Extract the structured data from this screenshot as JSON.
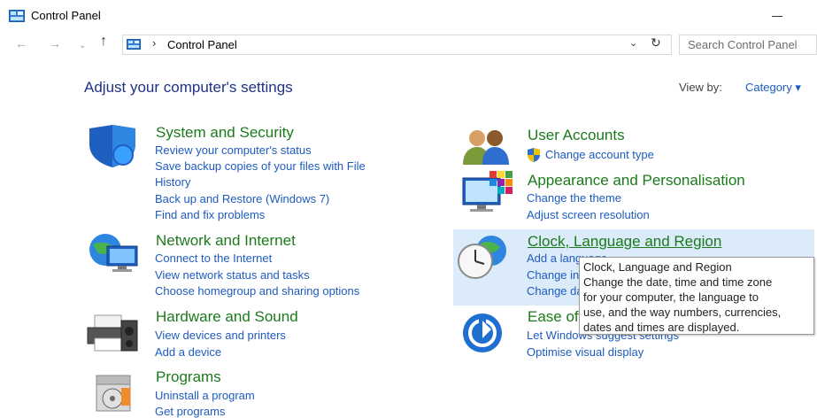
{
  "window": {
    "title": "Control Panel"
  },
  "nav": {
    "back": "←",
    "forward": "→",
    "recent": "⌄",
    "up": "↑",
    "address_separator": "›",
    "address_text": "Control Panel",
    "dropdown": "⌄",
    "refresh": "↻",
    "search_placeholder": "Search Control Panel"
  },
  "main": {
    "heading": "Adjust your computer's settings",
    "view_by_label": "View by:",
    "view_by_value": "Category ▾"
  },
  "categories_left": [
    {
      "title": "System and Security",
      "links": [
        "Review your computer's status",
        "Save backup copies of your files with File",
        "History",
        "Back up and Restore (Windows 7)",
        "Find and fix problems"
      ]
    },
    {
      "title": "Network and Internet",
      "links": [
        "Connect to the Internet",
        "View network status and tasks",
        "Choose homegroup and sharing options"
      ]
    },
    {
      "title": "Hardware and Sound",
      "links": [
        "View devices and printers",
        "Add a device"
      ]
    },
    {
      "title": "Programs",
      "links": [
        "Uninstall a program",
        "Get programs"
      ]
    }
  ],
  "categories_right": [
    {
      "title": "User Accounts",
      "links": [
        "Change account type"
      ]
    },
    {
      "title": "Appearance and Personalisation",
      "links": [
        "Change the theme",
        "Adjust screen resolution"
      ]
    },
    {
      "title": "Clock, Language and Region",
      "links": [
        "Add a language",
        "Change input methods",
        "Change date, time or number formats"
      ]
    },
    {
      "title": "Ease of Access",
      "links": [
        "Let Windows suggest settings",
        "Optimise visual display"
      ]
    }
  ],
  "tooltip": {
    "lines": [
      "Clock, Language and Region",
      "Change the date, time and time zone",
      "for your computer, the language to",
      "use, and the way numbers, currencies,",
      "dates and times are displayed."
    ]
  },
  "colors": {
    "heading": "#1e3287",
    "category_title": "#1b7a1b",
    "link": "#1e5bbf",
    "hover_highlight": "#dcebfa"
  }
}
